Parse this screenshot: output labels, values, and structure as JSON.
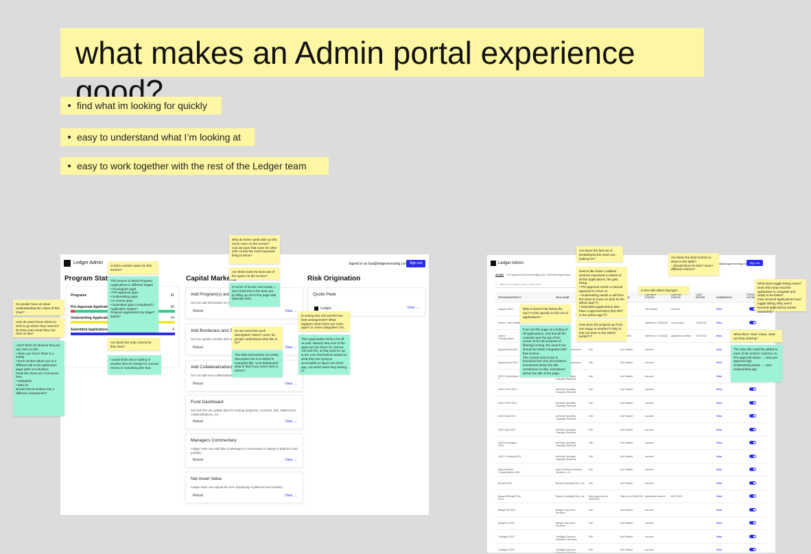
{
  "title": "what makes an Admin portal experience good?",
  "bullets": [
    "find what im looking for quickly",
    "easy to understand what I’m looking at",
    "easy to work together with the rest of the Ledger team"
  ],
  "left": {
    "app_name": "Ledger Admin",
    "signed_in": "Signed in as tsai@ledgerinvesting.com",
    "sign_out": "Sign out",
    "program_status": "Program Status",
    "status_rows": [
      {
        "label": "Programs",
        "count": "41"
      },
      {
        "label": "Pre-Approval Applications",
        "count": "20"
      },
      {
        "label": "Underwriting Applications",
        "count": "14"
      },
      {
        "label": "Submitted Applications",
        "count": "4"
      }
    ],
    "capital_markets": "Capital Markets",
    "risk_origination": "Risk Origination",
    "retool": "Retool",
    "view": "View →",
    "quote_peek": "Quote Peek",
    "ledger": "Ledger",
    "cards": [
      {
        "title": "Add Program(s) and Co",
        "desc": "CM can add information for ne"
      },
      {
        "title": "Add Borderaus and Settle",
        "desc": "CM can update monthly BDX and"
      },
      {
        "title": "Add Collateralization(s)",
        "desc": "CM can add new collateralization"
      },
      {
        "title": "Fund Dashboard",
        "desc": "CM and RO can update data for existing programs, contracts, bdx, settlements, collateralizations, etc."
      },
      {
        "title": "Managers Commentary",
        "desc": "Ledger team can add links to Manager's Commentary to display in platform fund portfolio."
      },
      {
        "title": "Net Asset Value",
        "desc": "Ledger team can upload the NAV displaying in platform fund portfolio."
      }
    ]
  },
  "notes_left": [
    "Is there a better name for this section?",
    "This section is about Program Applications in different stages\n• All program apps\n• Pre-approval apps\n• Underwriting apps\n• In review apps\n• Submitted apps (completed?)\nApplication stages?\nProgram applications by stage?\nstatus?",
    "Are these the only 4 items for this chart?",
    "I would think about adding in another item for Ready for manual review or something like that.",
    "Do people have an issue understanding the colors of this chart?",
    "How do users know where to click to go where they need to? Do they even know they can click on this?",
    "I don't think it's obvious that you can click on this.\n• when you hover there is a tooltip\n• Each section takes you to a different tab in the application page (also not intuitive)\nFeels like there are 2 functions here.\n• navigation\n• data viz\nshould this be broken into 2 different components?",
    "Why do these cards take up this much room on the screen?\nCan we save that room for other info? Is this the most important thing to show?",
    "Are these tools the best use of the space on the screen?",
    "In terms of screen real estate, I don't think this is the best use by filling up 2/3 of the page with basically links.",
    "Do we need this much description? More? Less? do people understand what this is for?",
    "The titles themselves are pretty descriptive but it is helpful in examples like \"Lost dashboard\" what is that if you never seen it before?",
    "Is sorting into CM and RO the best arrangement? What happens when there are more apps? or more categories? etc...",
    "This organization feels a bit off as well. Namely that a lot of the apps are not ONLY for CM but CM and RO, at that point it's up to the user themselves based on what they are trying to accomplish to figure out which app, not which team they belong to."
  ],
  "right": {
    "app_name": "Ledger Admin",
    "signed_in": "tsai@ledgerinvesting.com",
    "sign_out": "Sign out",
    "tabs": [
      "All (82)",
      "Pre-approval (33)",
      "Underwriting (33)",
      "Submitted Application"
    ],
    "search_placeholder": "Search by Program name, MGA name",
    "headers": [
      "PROGRAM/TREATY",
      "MGA NAME",
      "SUBMITTED",
      "STATUS",
      "CAP-APP STATUS",
      "CAPITAL STATUS",
      "LAST EDITED",
      "SUBMISSION",
      "TOGGLE LISTING"
    ],
    "rows": [
      [
        "Aegean 2022",
        "",
        "",
        "",
        "Not Started",
        "secured",
        "",
        "View",
        ""
      ],
      [
        "Amela - Hail Liability",
        "",
        "",
        "",
        "Started on 7/06/2022",
        "not-secured",
        "7/08/2023",
        "View",
        ""
      ],
      [
        "Alamo Transportation",
        "",
        "",
        "Submitted",
        "Started on 7/11/2022",
        "application started",
        "7/11/2023",
        "View",
        ""
      ],
      [
        "Appalachian 2021",
        "Appalachian Insurance",
        "N/A",
        "Not Started",
        "secured",
        "",
        "",
        "View",
        ""
      ],
      [
        "Appalachian 2022",
        "Appalachian Insurance",
        "N/A",
        "Not Started",
        "secured",
        "",
        "",
        "View",
        ""
      ],
      [
        "2022 Consolidated F...",
        "AmWins Specialty Casualty Solutions",
        "N/A",
        "Not Started",
        "secured",
        "",
        "",
        "View",
        ""
      ],
      [
        "ASCS PEO 2021",
        "AmWins Specialty Casualty Solutions",
        "N/A",
        "Not Started",
        "secured",
        "",
        "",
        "View",
        ""
      ],
      [
        "ASCS PEO 2022",
        "AmWins Specialty Casualty Solutions",
        "N/A",
        "Not Started",
        "secured",
        "",
        "",
        "View",
        ""
      ],
      [
        "ASCS Nat 2021",
        "AmWins Specialty Casualty Solutions",
        "N/A",
        "Not Started",
        "secured",
        "",
        "",
        "View",
        ""
      ],
      [
        "ASCS Nat 2022",
        "AmWins Specialty Casualty Solutions",
        "N/A",
        "Not Started",
        "secured",
        "",
        "",
        "View",
        ""
      ],
      [
        "ASCS Hourglass 2022",
        "AmWins Specialty Casualty Solutions",
        "N/A",
        "Not Started",
        "secured",
        "",
        "",
        "View",
        ""
      ],
      [
        "ASCS Trucking 2021",
        "AmWins Specialty Casualty Solutions",
        "N/A",
        "Not Started",
        "secured",
        "",
        "",
        "View",
        ""
      ],
      [
        "Atlas Workers' Compensation 2022",
        "Atlas General Insurance Services, LLC",
        "N/A",
        "Not Started",
        "secured",
        "",
        "",
        "View",
        ""
      ],
      [
        "Bravos 2022",
        "Bravos Specialty Risk, Inc",
        "N/A",
        "Not Started",
        "secured",
        "",
        "",
        "View",
        ""
      ],
      [
        "Bravos Mileage Plus 2023",
        "Bravos Specialty Risk, Inc",
        "Seen approved in 9/28/2022",
        "Started on 9/28/2022",
        "Application started",
        "6/27/2023",
        "",
        "View",
        ""
      ],
      [
        "BridgeCIS 2022",
        "Bridger Insurance Services",
        "N/A",
        "Not Started",
        "secured",
        "",
        "",
        "View",
        ""
      ],
      [
        "BridgeTix 2022",
        "Bridger Insurance Services",
        "N/A",
        "Not Started",
        "secured",
        "",
        "",
        "View",
        ""
      ],
      [
        "Cardigan 2021",
        "Cardigan General Insurance Services",
        "N/A",
        "Not Started",
        "secured",
        "",
        "",
        "View",
        ""
      ],
      [
        "Cardigan 2022",
        "Cardigan General Insurance Services",
        "N/A",
        "Not Started",
        "secured",
        "",
        "",
        "View",
        ""
      ]
    ]
  },
  "notes_right": [
    "Are these the first set of breakdowns the users are looking for?",
    "Seems like these 4 tabbed sections represent a subset of all the applications, the gets being\n• Pre-approval needs a manual approval to move on\n• Underwriting needs a call from RO team to move on (Not IN the admin app??)\n• Submitted applications also have a approve/reject (but NOT in the admin app??)",
    "How does the program go from one stage to another?? why is that not done in the admin portal???",
    "Are these the best metrics to show in the table?\n- Should there be less? more? different metrics?",
    "Is this still called CapApp?",
    "Why is search bar below the nav? Is this specific to this set of applications?",
    "If we set this page as a listing of all applications, and that all the controls near the top of the screen is for the purpose of filtering/ sorting, the search bar should be better integrated with that section.\nThe current search bar is functional but very inconsistent, sometimes below the title sometimes no title, sometimes above the title of the page.",
    "What does toggle listing mean? Does this mean that the application is complete and ready to be listed?\nOnly secured applications have toggle listing; Why aren't secured applications sorted separately?",
    "What does \"view\" mean, what are they viewing?",
    "The view link could be added to each of the section columns, ie,\nPre-approval status → view pre-approval app\nUnderwriting status → view underwriting app"
  ]
}
